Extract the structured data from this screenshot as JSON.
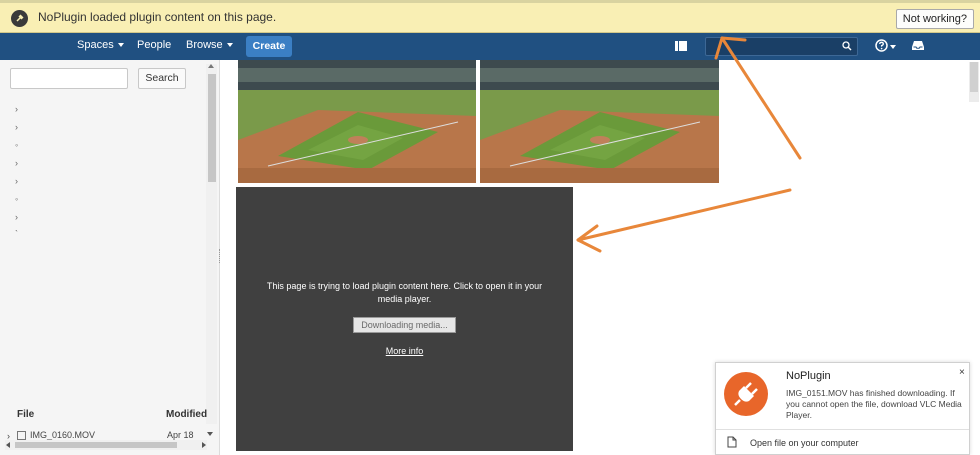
{
  "infobar": {
    "message": "NoPlugin loaded plugin content on this page.",
    "button_label": "Not working?"
  },
  "navbar": {
    "items": [
      {
        "label": "Spaces",
        "has_dropdown": true
      },
      {
        "label": "People",
        "has_dropdown": false
      },
      {
        "label": "Browse",
        "has_dropdown": true
      }
    ],
    "create_label": "Create",
    "search_value": "",
    "icons": [
      "sidebar-toggle-icon",
      "search-icon",
      "help-icon",
      "inbox-icon"
    ],
    "background_color": "#205081",
    "accent_color": "#3b7fc4"
  },
  "sidebar": {
    "search_value": "",
    "search_button": "Search",
    "tree_markers": [
      "›",
      "›",
      "◦",
      "›",
      "›",
      "◦",
      "›",
      "`"
    ],
    "columns": {
      "file": "File",
      "modified": "Modified"
    },
    "rows": [
      {
        "name": "IMG_0160.MOV",
        "modified": "Apr 18"
      }
    ]
  },
  "plugin": {
    "message": "This page is trying to load plugin content here. Click to open it in your media player.",
    "button_label": "Downloading media...",
    "link_label": "More info"
  },
  "notification": {
    "title": "NoPlugin",
    "body": "IMG_0151.MOV has finished downloading. If you cannot open the file, download VLC Media Player.",
    "close_label": "×",
    "action_label": "Open file on your computer",
    "icon_color": "#e8662a"
  },
  "annotation_color": "#e8873a"
}
